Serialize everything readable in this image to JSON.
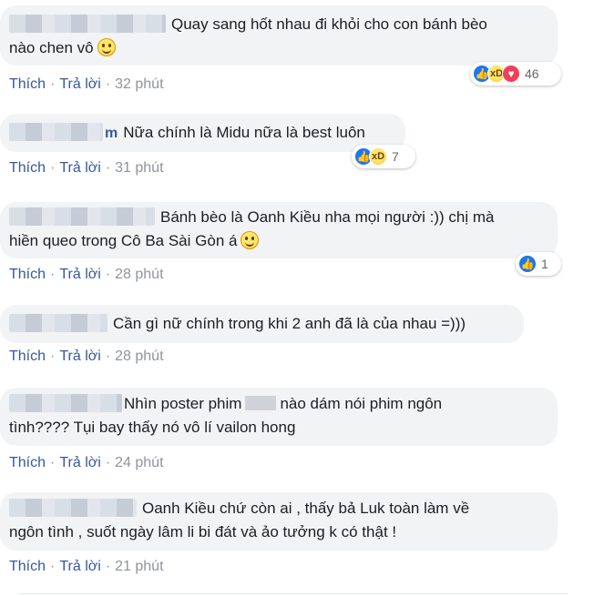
{
  "colors": {
    "bubble": "#f2f3f5",
    "link": "#385898",
    "meta": "#90949c",
    "like": "#1877f2",
    "love": "#f33e58",
    "haha": "#f7c32e"
  },
  "actions": {
    "like": "Thích",
    "reply": "Trả lời",
    "separator": "·"
  },
  "comments": [
    {
      "name_suffix": "",
      "text_line1": "Quay sang hốt nhau đi khỏi cho con bánh bèo",
      "text_line2": "nào chen vô",
      "emoji": "slightly-smiling-face-icon",
      "time": "32 phút",
      "reactions": {
        "icons": [
          "like-icon",
          "haha-icon",
          "love-icon"
        ],
        "count": "46"
      }
    },
    {
      "name_suffix": "m",
      "text_line1": "Nữa chính là Midu nữa là best luôn",
      "time": "31 phút",
      "reactions": {
        "icons": [
          "like-icon",
          "haha-icon"
        ],
        "count": "7"
      }
    },
    {
      "name_suffix": "",
      "text_line1": "Bánh bèo là Oanh Kiều nha mọi người :)) chị mà",
      "text_line2": "hiền queo trong Cô Ba Sài Gòn á",
      "emoji": "slightly-smiling-face-icon",
      "time": "28 phút",
      "reactions": {
        "icons": [
          "like-icon"
        ],
        "count": "1"
      }
    },
    {
      "name_suffix": "",
      "text_line1": "Cần gì nữ chính trong khi 2 anh đã là của nhau =)))",
      "time": "28 phút"
    },
    {
      "name_suffix": "",
      "text_line1a": "Nhìn poster phim",
      "text_line1b": "nào dám nói phim ngôn",
      "text_line2": "tình???? Tụi bay thấy nó vô lí vailon hong",
      "time": "24 phút"
    },
    {
      "name_suffix": "",
      "text_line1": "Oanh Kiều chứ còn ai , thấy bả Luk toàn làm về",
      "text_line2": "ngôn tình , suốt ngày lâm li bi đát và ảo tưởng k có thật !",
      "time": "21 phút"
    }
  ]
}
